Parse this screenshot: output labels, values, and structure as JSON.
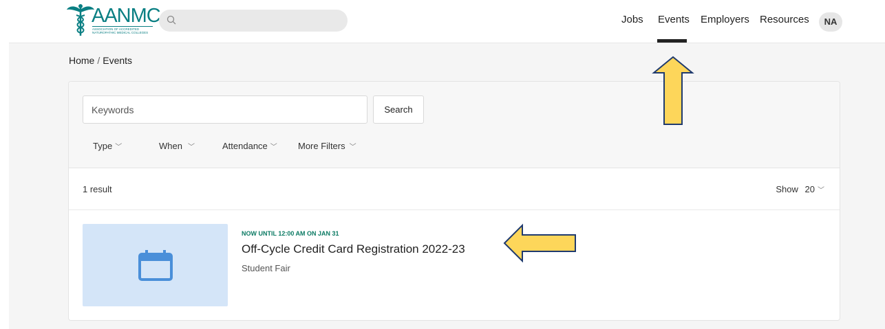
{
  "header": {
    "logo_text": "AANMC",
    "logo_subtext": "Association of Accredited Naturopathic Medical Colleges",
    "nav": [
      {
        "label": "Jobs"
      },
      {
        "label": "Events"
      },
      {
        "label": "Employers"
      },
      {
        "label": "Resources"
      }
    ],
    "active_nav": "Events",
    "avatar_initials": "NA"
  },
  "breadcrumb": {
    "home": "Home",
    "separator": "/",
    "current": "Events"
  },
  "filters": {
    "keywords_placeholder": "Keywords",
    "search_label": "Search",
    "dropdowns": [
      {
        "label": "Type"
      },
      {
        "label": "When"
      },
      {
        "label": "Attendance"
      },
      {
        "label": "More Filters"
      }
    ]
  },
  "results": {
    "count_text": "1 result",
    "show_label": "Show",
    "show_value": "20"
  },
  "events": [
    {
      "date_text": "NOW UNTIL 12:00 AM ON JAN 31",
      "title": "Off-Cycle Credit Card Registration 2022-23",
      "type": "Student Fair"
    }
  ],
  "colors": {
    "brand": "#0a7f83",
    "date_text": "#0b7a63",
    "thumb_bg": "#d4e5f8",
    "calendar_icon": "#4a8fd9",
    "annotation_fill": "#fdd65a",
    "annotation_stroke": "#1f3a6e"
  },
  "icons": {
    "logo": "caduceus-icon",
    "search": "search-icon",
    "event": "calendar-icon",
    "dropdown": "chevron-down-icon"
  }
}
